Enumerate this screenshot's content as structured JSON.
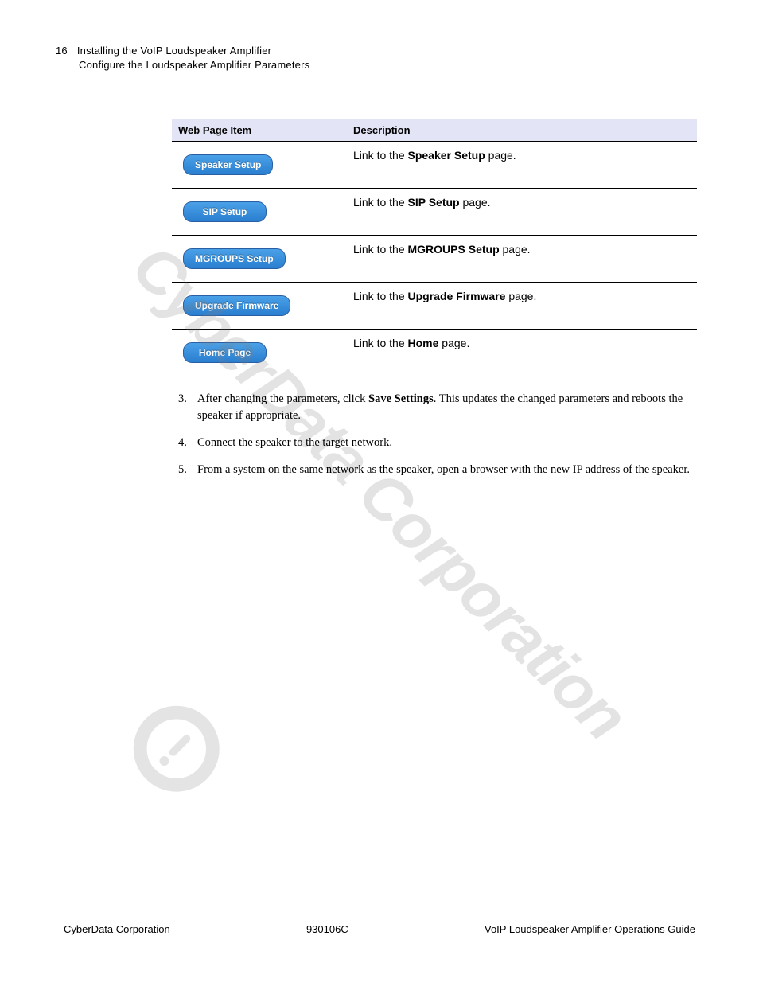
{
  "header": {
    "page_number": "16",
    "title_line1": "Installing the VoIP Loudspeaker Amplifier",
    "title_line2": "Configure the Loudspeaker Amplifier Parameters"
  },
  "table": {
    "head_item": "Web Page Item",
    "head_desc": "Description",
    "rows": [
      {
        "button": "Speaker Setup",
        "desc_prefix": "Link to the ",
        "desc_bold": "Speaker Setup",
        "desc_suffix": " page."
      },
      {
        "button": "SIP Setup",
        "desc_prefix": "Link to the ",
        "desc_bold": "SIP Setup",
        "desc_suffix": " page."
      },
      {
        "button": "MGROUPS Setup",
        "desc_prefix": "Link to the ",
        "desc_bold": "MGROUPS Setup",
        "desc_suffix": " page."
      },
      {
        "button": "Upgrade Firmware",
        "desc_prefix": "Link to the ",
        "desc_bold": "Upgrade Firmware",
        "desc_suffix": " page."
      },
      {
        "button": "Home Page",
        "desc_prefix": "Link to the ",
        "desc_bold": "Home",
        "desc_suffix": " page."
      }
    ]
  },
  "steps": [
    {
      "num": "3.",
      "prefix": "After changing the parameters, click ",
      "bold": "Save Settings",
      "suffix": ". This updates the changed parameters and reboots the speaker if appropriate."
    },
    {
      "num": "4.",
      "prefix": "Connect the speaker to the target network.",
      "bold": "",
      "suffix": ""
    },
    {
      "num": "5.",
      "prefix": "From a system on the same network as the speaker, open a browser with the new IP address of the speaker.",
      "bold": "",
      "suffix": ""
    }
  ],
  "footer": {
    "left": "CyberData Corporation",
    "center": "930106C",
    "right": "VoIP Loudspeaker Amplifier Operations Guide"
  },
  "watermark": "CyberData Corporation"
}
